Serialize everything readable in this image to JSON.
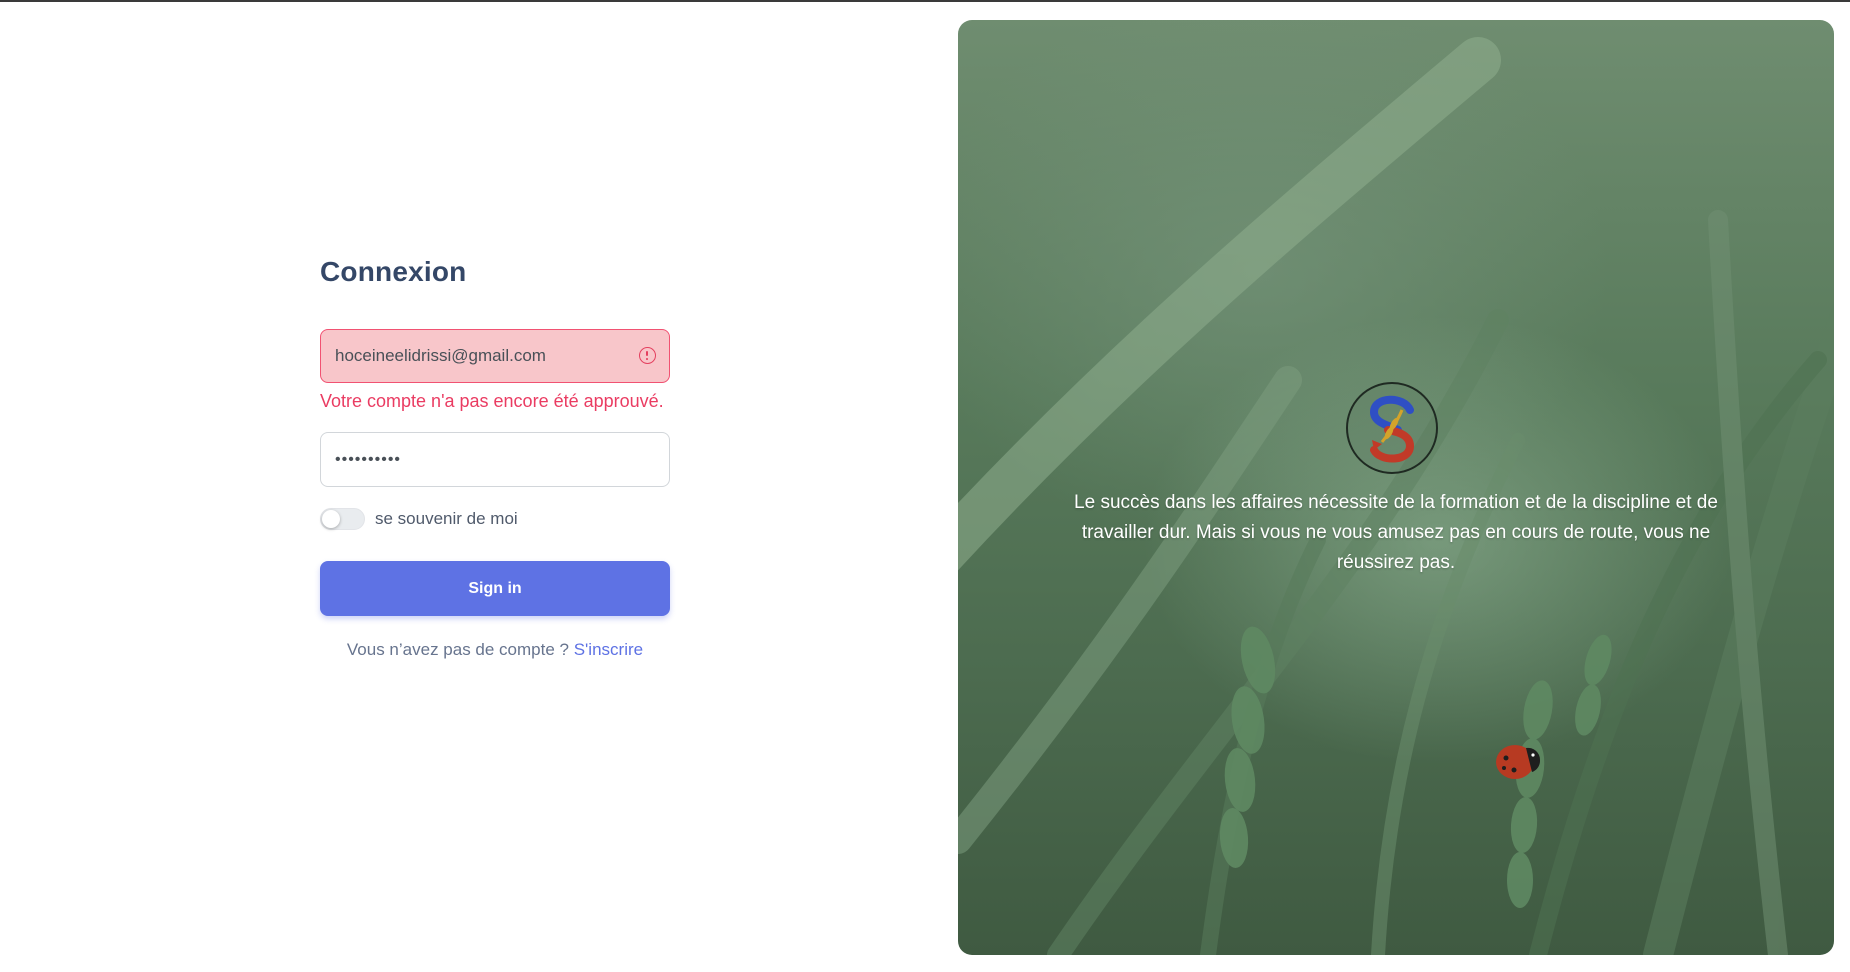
{
  "login": {
    "title": "Connexion",
    "email_value": "hoceineelidrissi@gmail.com",
    "email_error": "Votre compte n'a pas encore été approuvé.",
    "password_value": "••••••••••",
    "remember_label": "se souvenir de moi",
    "remember_checked": false,
    "sign_in_label": "Sign in",
    "no_account_text": "Vous n’avez pas de compte ?",
    "signup_link": "S'inscrire"
  },
  "panel": {
    "quote": "Le succès dans les affaires nécessite de la formation et de la discipline et de travailler dur. Mais si vous ne vous amusez pas en cours de route, vous ne réussirez pas.",
    "logo_icon": "s-leaf-logo",
    "background_image": "green-wheat-field-with-ladybug"
  },
  "colors": {
    "primary": "#5e72e4",
    "error": "#ea3c62",
    "error_bg": "#f8c6ca",
    "heading": "#344767"
  }
}
